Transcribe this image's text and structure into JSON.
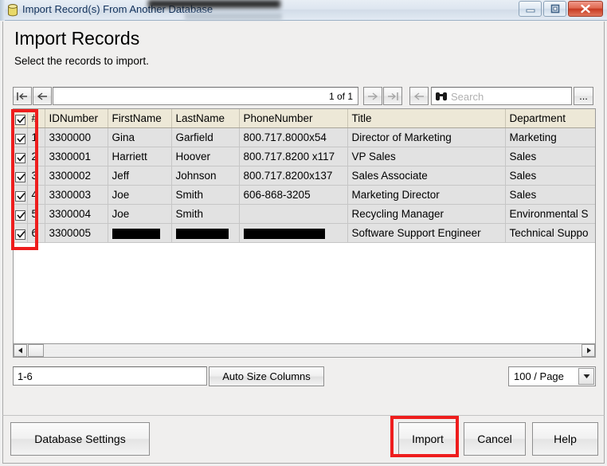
{
  "window": {
    "title": "Import Record(s) From Another Database",
    "icon": "database-icon",
    "controls": {
      "minimize": "minimize-icon",
      "maximize": "maximize-icon",
      "close": "close-icon"
    }
  },
  "page": {
    "title": "Import Records",
    "subtitle": "Select the records to import."
  },
  "navbar": {
    "first_page_label": "⇤",
    "prev_page_label": "⇐",
    "page_indicator": "1 of 1",
    "next_page_label": "⇒",
    "last_page_label": "⇥",
    "back_label": "⇐",
    "search_placeholder": "Search",
    "search_value": "",
    "ellipsis_label": "...",
    "forward_label": "⇒",
    "nav_field_value": ""
  },
  "table": {
    "columns": [
      "",
      "#",
      "IDNumber",
      "FirstName",
      "LastName",
      "PhoneNumber",
      "Title",
      "Department"
    ],
    "header_checkbox_checked": true,
    "rows": [
      {
        "checked": true,
        "num": "1",
        "id": "3300000",
        "first": "Gina",
        "last": "Garfield",
        "phone": "800.717.8000x54",
        "title": "Director of Marketing",
        "department": "Marketing",
        "redacted": []
      },
      {
        "checked": true,
        "num": "2",
        "id": "3300001",
        "first": "Harriett",
        "last": "Hoover",
        "phone": "800.717.8200 x117",
        "title": "VP Sales",
        "department": "Sales",
        "redacted": []
      },
      {
        "checked": true,
        "num": "3",
        "id": "3300002",
        "first": "Jeff",
        "last": "Johnson",
        "phone": "800.717.8200x137",
        "title": "Sales Associate",
        "department": "Sales",
        "redacted": []
      },
      {
        "checked": true,
        "num": "4",
        "id": "3300003",
        "first": "Joe",
        "last": "Smith",
        "phone": "606-868-3205",
        "title": "Marketing Director",
        "department": "Sales",
        "redacted": []
      },
      {
        "checked": true,
        "num": "5",
        "id": "3300004",
        "first": "Joe",
        "last": "Smith",
        "phone": "",
        "title": "Recycling Manager",
        "department": "Environmental S",
        "redacted": []
      },
      {
        "checked": true,
        "num": "6",
        "id": "3300005",
        "first": "",
        "last": "",
        "phone": "",
        "title": "Software Support Engineer",
        "department": "Technical Suppo",
        "redacted": [
          "first",
          "last",
          "phone"
        ]
      }
    ]
  },
  "bottom_controls": {
    "range_value": "1-6",
    "autosize_label": "Auto Size Columns",
    "per_page_value": "100 / Page"
  },
  "footer": {
    "database_settings_label": "Database Settings",
    "import_label": "Import",
    "cancel_label": "Cancel",
    "help_label": "Help"
  },
  "annotations": {
    "checkbox_column_highlight": true,
    "import_button_highlight": true,
    "color": "#ee1d1d"
  }
}
